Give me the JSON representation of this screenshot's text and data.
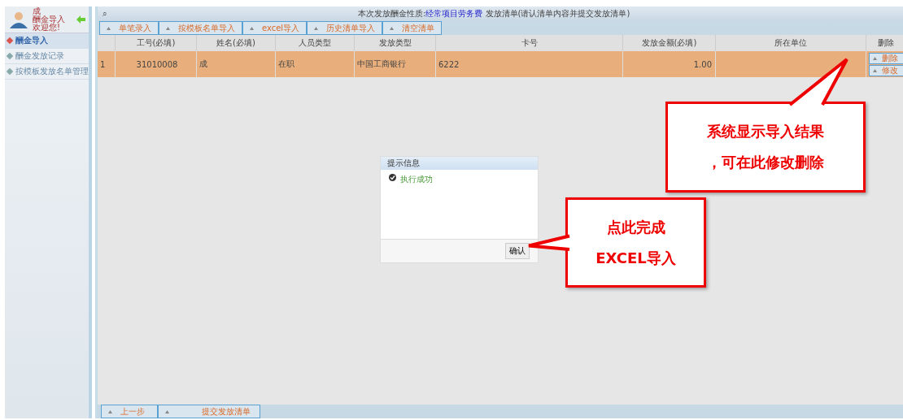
{
  "user": {
    "lines": [
      "成",
      "酬金导入",
      "欢迎您!"
    ]
  },
  "sidebar": {
    "items": [
      {
        "label": "酬金导入",
        "selected": true
      },
      {
        "label": "酬金发放记录",
        "selected": false
      },
      {
        "label": "按模板发放名单管理",
        "selected": false
      }
    ]
  },
  "header": {
    "search_icon": "⌕",
    "text_before": "本次发放酬金性质:",
    "link": "经常项目劳务费",
    "text_after": "发放清单(请认清单内容并提交发放清单)"
  },
  "toolbar": [
    "单笔录入",
    "按模板名单导入",
    "excel导入",
    "历史清单导入",
    "清空清单"
  ],
  "table": {
    "columns": [
      "工号(必填)",
      "姓名(必填)",
      "人员类型",
      "发放类型",
      "卡号",
      "发放金额(必填)",
      "所在单位",
      "删除"
    ],
    "rows": [
      {
        "index": "1",
        "cells": [
          "31010008",
          "成",
          "在职",
          "中国工商银行",
          "6222",
          "1.00",
          ""
        ],
        "actions": [
          "删除",
          "修改"
        ],
        "selected": true
      }
    ]
  },
  "dialog": {
    "title": "提示信息",
    "message": "执行成功",
    "button": "确认"
  },
  "bottom_toolbar": [
    "上一步",
    "提交发放清单"
  ],
  "callouts": [
    {
      "lines": [
        "系统显示导入结果",
        "，可在此修改删除"
      ]
    },
    {
      "lines": [
        "点此完成",
        "EXCEL导入"
      ]
    }
  ]
}
